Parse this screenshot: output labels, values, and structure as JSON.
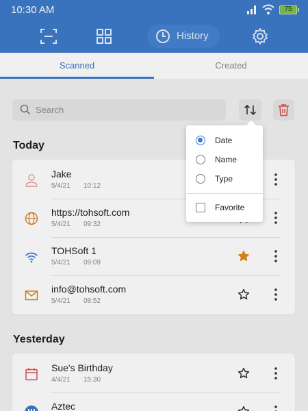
{
  "status_bar": {
    "time": "10:30 AM",
    "battery": "75"
  },
  "nav": {
    "history_label": "History"
  },
  "tabs": {
    "scanned": "Scanned",
    "created": "Created"
  },
  "search": {
    "placeholder": "Search"
  },
  "sections": [
    {
      "title": "Today",
      "items": [
        {
          "icon": "person-icon",
          "title": "Jake",
          "date": "5/4/21",
          "time": "10:12",
          "favorite": false
        },
        {
          "icon": "globe-icon",
          "title": "https://tohsoft.com",
          "date": "5/4/21",
          "time": "09:32",
          "favorite": false
        },
        {
          "icon": "wifi-icon",
          "title": "TOHSoft 1",
          "date": "5/4/21",
          "time": "09:09",
          "favorite": true
        },
        {
          "icon": "email-icon",
          "title": "info@tohsoft.com",
          "date": "5/4/21",
          "time": "08:52",
          "favorite": false
        }
      ]
    },
    {
      "title": "Yesterday",
      "items": [
        {
          "icon": "calendar-icon",
          "title": "Sue's Birthday",
          "date": "4/4/21",
          "time": "15:30",
          "favorite": false
        },
        {
          "icon": "aztec-icon",
          "title": "Aztec",
          "date": "",
          "time": "",
          "favorite": false
        }
      ]
    }
  ],
  "sort_menu": {
    "options": [
      "Date",
      "Name",
      "Type"
    ],
    "selected": "Date",
    "favorite_label": "Favorite",
    "favorite_checked": false
  },
  "colors": {
    "primary": "#3d7ac9",
    "star_filled": "#e08a1e",
    "trash": "#d9534f",
    "contact": "#e8a1a1",
    "url": "#e67e22",
    "wifi": "#3d7ac9",
    "email": "#e67e22",
    "calendar": "#d9534f"
  }
}
